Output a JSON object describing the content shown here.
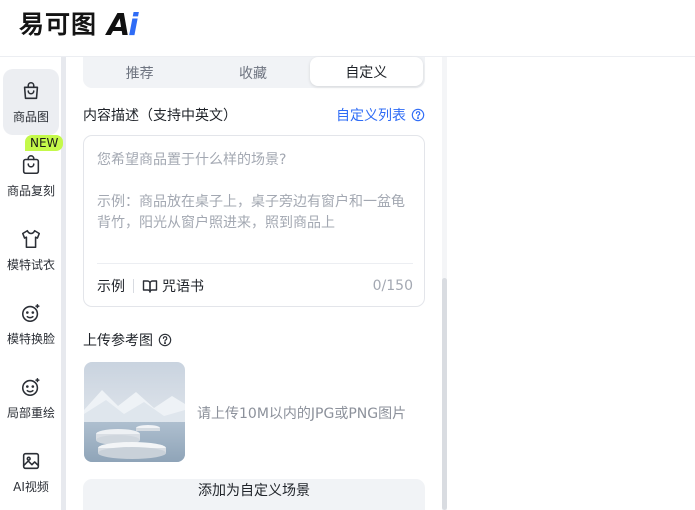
{
  "header": {
    "logo_text": "易可图",
    "logo_ai_a": "A",
    "logo_ai_i": "i"
  },
  "sidebar": {
    "items": [
      {
        "label": "商品图",
        "icon": "bag-icon",
        "active": true
      },
      {
        "label": "商品复刻",
        "icon": "bag-copy-icon",
        "active": false
      },
      {
        "label": "模特试衣",
        "icon": "shirt-icon",
        "active": false
      },
      {
        "label": "模特换脸",
        "icon": "face-swap-icon",
        "active": false
      },
      {
        "label": "局部重绘",
        "icon": "face-repaint-icon",
        "active": false
      },
      {
        "label": "AI视频",
        "icon": "video-icon",
        "active": false
      }
    ],
    "new_badge": "NEW"
  },
  "tabs": [
    {
      "label": "推荐",
      "active": false
    },
    {
      "label": "收藏",
      "active": false
    },
    {
      "label": "自定义",
      "active": true
    }
  ],
  "description": {
    "title": "内容描述（支持中英文）",
    "custom_list_link": "自定义列表",
    "placeholder": "您希望商品置于什么样的场景?\n\n示例：商品放在桌子上，桌子旁边有窗户和一盆龟背竹，阳光从窗户照进来，照到商品上",
    "example_button": "示例",
    "spellbook_button": "咒语书",
    "counter": "0/150"
  },
  "upload": {
    "title": "上传参考图",
    "hint": "请上传10M以内的JPG或PNG图片"
  },
  "add_button": "添加为自定义场景",
  "colors": {
    "accent": "#2f6cf6",
    "new_badge": "#c4f94a"
  }
}
